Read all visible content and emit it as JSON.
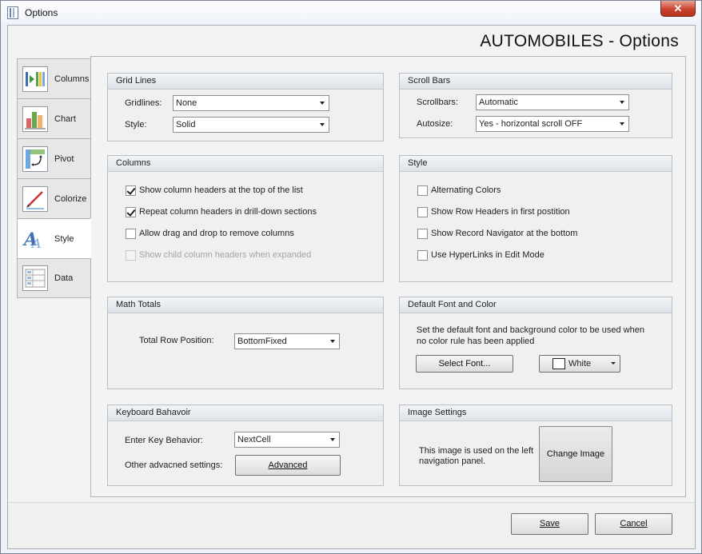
{
  "window": {
    "title": "Options",
    "close_glyph": "✕"
  },
  "header": {
    "title": "AUTOMOBILES - Options"
  },
  "nav": {
    "items": [
      {
        "label": "Columns",
        "icon": "columns-icon"
      },
      {
        "label": "Chart",
        "icon": "bar-chart-icon"
      },
      {
        "label": "Pivot",
        "icon": "pivot-icon"
      },
      {
        "label": "Colorize",
        "icon": "colorize-icon"
      },
      {
        "label": "Style",
        "icon": "style-icon"
      },
      {
        "label": "Data",
        "icon": "data-icon"
      }
    ],
    "active": "Style"
  },
  "grid_lines": {
    "title": "Grid Lines",
    "gridlines_label": "Gridlines:",
    "gridlines_value": "None",
    "style_label": "Style:",
    "style_value": "Solid"
  },
  "scroll_bars": {
    "title": "Scroll Bars",
    "scrollbars_label": "Scrollbars:",
    "scrollbars_value": "Automatic",
    "autosize_label": "Autosize:",
    "autosize_value": "Yes - horizontal scroll OFF"
  },
  "columns": {
    "title": "Columns",
    "options": [
      {
        "label": "Show column headers at the top of the list",
        "checked": true,
        "enabled": true
      },
      {
        "label": "Repeat column headers in drill-down sections",
        "checked": true,
        "enabled": true
      },
      {
        "label": "Allow drag and drop to remove columns",
        "checked": false,
        "enabled": true
      },
      {
        "label": "Show child column headers when expanded",
        "checked": false,
        "enabled": false
      }
    ]
  },
  "style": {
    "title": "Style",
    "options": [
      {
        "label": "Alternating Colors",
        "checked": false
      },
      {
        "label": "Show Row Headers in first postition",
        "checked": false
      },
      {
        "label": "Show Record Navigator at the bottom",
        "checked": false
      },
      {
        "label": "Use HyperLinks in Edit Mode",
        "checked": false
      }
    ]
  },
  "math_totals": {
    "title": "Math Totals",
    "total_row_label": "Total Row Position:",
    "total_row_value": "BottomFixed"
  },
  "default_font": {
    "title": "Default Font and Color",
    "description": "Set the default font and background color to be used when no color rule has been applied",
    "select_font_label": "Select Font...",
    "color_value": "White",
    "color_swatch": "#ffffff"
  },
  "keyboard": {
    "title": "Keyboard Bahavoir",
    "enter_key_label": "Enter Key Behavior:",
    "enter_key_value": "NextCell",
    "other_label": "Other advacned settings:",
    "advanced_label": "Advanced"
  },
  "image_settings": {
    "title": "Image Settings",
    "description": "This image is used on the left navigation panel.",
    "change_image_label": "Change Image"
  },
  "footer": {
    "save_label": "Save",
    "cancel_label": "Cancel"
  }
}
